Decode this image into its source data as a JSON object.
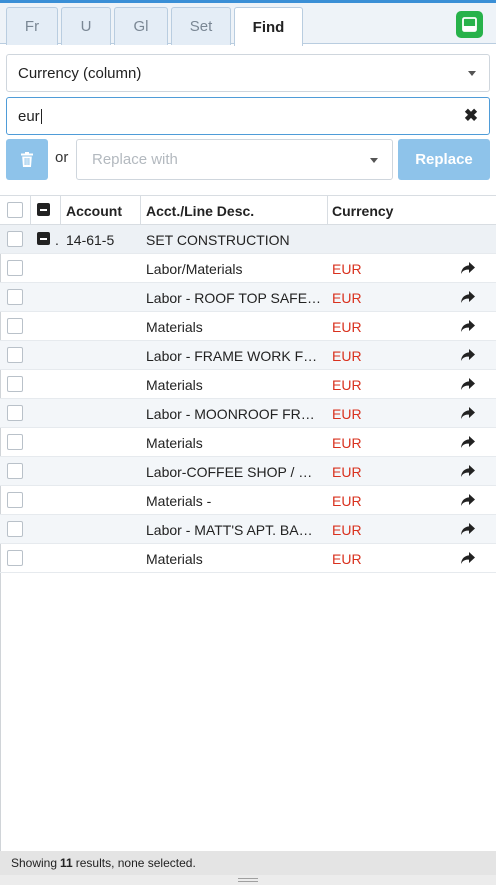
{
  "tabs": [
    {
      "label": "Fr",
      "active": false
    },
    {
      "label": "U",
      "active": false
    },
    {
      "label": "Gl",
      "active": false
    },
    {
      "label": "Set",
      "active": false
    },
    {
      "label": "Find",
      "active": true
    }
  ],
  "find": {
    "column_select": "Currency (column)",
    "search_value": "eur",
    "or_label": "or",
    "replace_placeholder": "Replace with",
    "replace_button": "Replace"
  },
  "grid": {
    "headers": {
      "account": "Account",
      "desc": "Acct./Line Desc.",
      "currency": "Currency"
    },
    "group": {
      "account": "14-61-5",
      "desc": "SET CONSTRUCTION"
    },
    "rows": [
      {
        "desc": "Labor/Materials",
        "currency": "EUR"
      },
      {
        "desc": "Labor - ROOF TOP SAFE…",
        "currency": "EUR"
      },
      {
        "desc": "Materials",
        "currency": "EUR"
      },
      {
        "desc": "Labor - FRAME WORK F…",
        "currency": "EUR"
      },
      {
        "desc": "Materials",
        "currency": "EUR"
      },
      {
        "desc": "Labor - MOONROOF FR…",
        "currency": "EUR"
      },
      {
        "desc": "Materials",
        "currency": "EUR"
      },
      {
        "desc": "Labor-COFFEE SHOP / …",
        "currency": "EUR"
      },
      {
        "desc": "Materials -",
        "currency": "EUR"
      },
      {
        "desc": "Labor - MATT'S APT. BA…",
        "currency": "EUR"
      },
      {
        "desc": "Materials",
        "currency": "EUR"
      }
    ]
  },
  "footer": {
    "prefix": "Showing",
    "count": "11",
    "suffix": "results, none selected."
  },
  "colors": {
    "accent": "#3a8fd6",
    "currency_text": "#d9311e",
    "panel_button": "#27b24a"
  }
}
